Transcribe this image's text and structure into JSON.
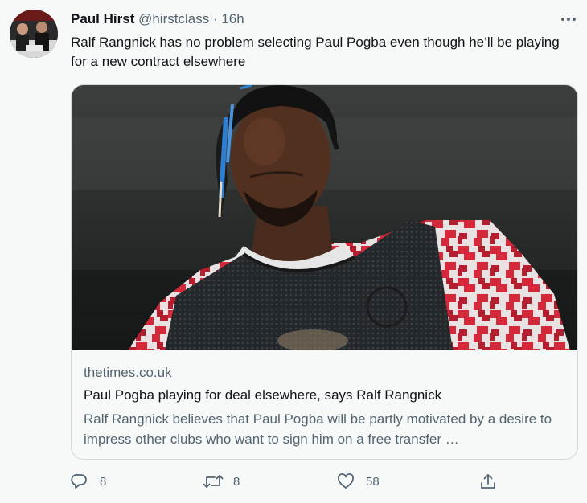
{
  "tweet": {
    "author": {
      "name": "Paul Hirst",
      "handle": "@hirstclass",
      "separator": "·",
      "time": "16h"
    },
    "text": "Ralf Rangnick has no problem selecting Paul Pogba even though he’ll be playing for a new contract elsewhere",
    "card": {
      "domain": "thetimes.co.uk",
      "title": "Paul Pogba playing for deal elsewhere, says Ralf Rangnick",
      "description": "Ralf Rangnick believes that Paul Pogba will be partly motivated by a desire to impress other clubs who want to sign him on a free transfer …"
    },
    "actions": {
      "replies": "8",
      "retweets": "8",
      "likes": "58"
    }
  },
  "icons": {
    "more": "more-horizontal-icon",
    "reply": "reply-icon",
    "retweet": "retweet-icon",
    "like": "like-icon",
    "share": "share-icon"
  },
  "colors": {
    "background": "#f7f9f9",
    "primary_text": "#0f1419",
    "secondary_text": "#536471",
    "border": "#cfd9de"
  }
}
